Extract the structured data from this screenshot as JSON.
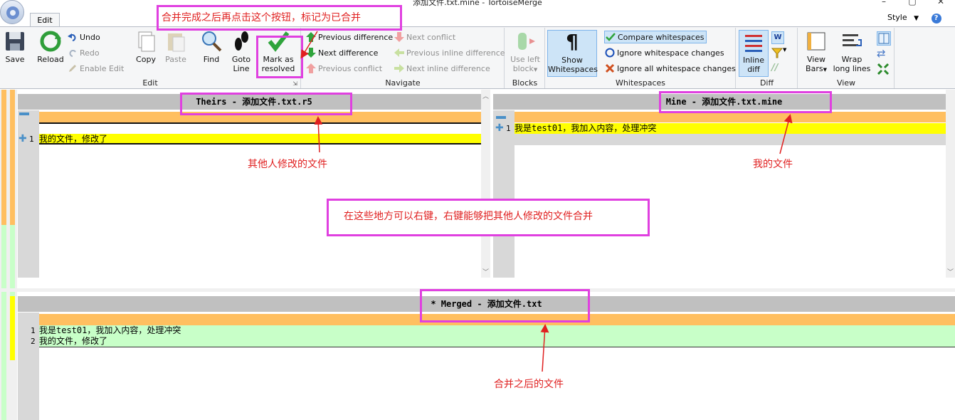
{
  "window": {
    "title": "添加文件.txt.mine - TortoiseMerge",
    "minimize": "–",
    "restore": "▢",
    "close": "✕"
  },
  "ribbon": {
    "tab": "Edit",
    "style_menu": "Style",
    "groups": {
      "edit": {
        "label": "Edit",
        "save": "Save",
        "reload": "Reload",
        "undo": "Undo",
        "redo": "Redo",
        "enable_edit": "Enable Edit",
        "copy": "Copy",
        "paste": "Paste",
        "find": "Find",
        "goto_line": [
          "Goto",
          "Line"
        ],
        "mark_resolved": [
          "Mark as",
          "resolved"
        ]
      },
      "navigate": {
        "label": "Navigate",
        "prev_diff": "Previous difference",
        "next_diff": "Next difference",
        "prev_conflict": "Previous conflict",
        "next_conflict": "Next conflict",
        "prev_inline": "Previous inline difference",
        "next_inline": "Next inline difference"
      },
      "blocks": {
        "label": "Blocks",
        "use_left": [
          "Use left",
          "block"
        ]
      },
      "whitespaces": {
        "label": "Whitespaces",
        "show_ws": [
          "Show",
          "Whitespaces"
        ],
        "compare": "Compare whitespaces",
        "ignore_changes": "Ignore whitespace changes",
        "ignore_all": "Ignore all whitespace changes"
      },
      "diff": {
        "label": "Diff",
        "inline": [
          "Inline",
          "diff"
        ]
      },
      "view": {
        "label": "View",
        "view_bars": [
          "View",
          "Bars"
        ],
        "wrap": [
          "Wrap",
          "long lines"
        ]
      }
    }
  },
  "panes": {
    "theirs": {
      "header": "Theirs - 添加文件.txt.r5",
      "lines": [
        {
          "num": "1",
          "text": "我的文件，修改了"
        }
      ]
    },
    "mine": {
      "header": "Mine - 添加文件.txt.mine",
      "lines": [
        {
          "num": "1",
          "text": "我是test01，我加入内容，处理冲突"
        }
      ]
    },
    "merged": {
      "header": "* Merged - 添加文件.txt",
      "lines": [
        {
          "num": "1",
          "text": "我是test01，我加入内容，处理冲突"
        },
        {
          "num": "2",
          "text": "我的文件，修改了"
        }
      ]
    }
  },
  "annotations": {
    "top": "合并完成之后再点击这个按钮，标记为已合并",
    "theirs": "其他人修改的文件",
    "mine": "我的文件",
    "middle": "在这些地方可以右键，右键能够把其他人修改的文件合并",
    "merged": "合并之后的文件"
  },
  "colors": {
    "conflict": "#ffbf60",
    "yellow": "#ffff00",
    "merged_added": "#c8ffc8",
    "annotation": "#e040e0",
    "arrow": "#e02020"
  }
}
